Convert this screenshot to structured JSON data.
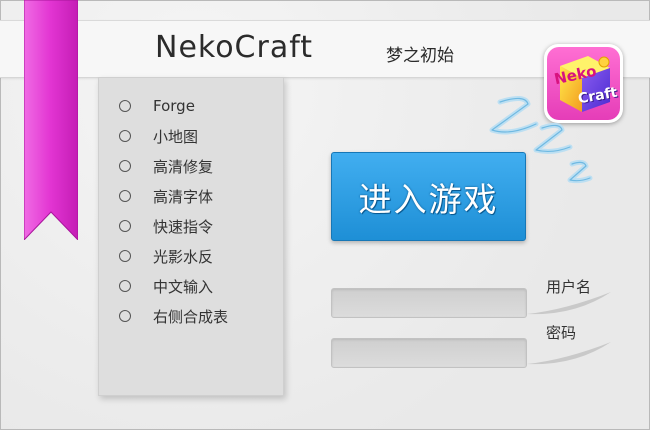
{
  "app": {
    "title": "NekoCraft",
    "subtitle": "梦之初始"
  },
  "logo": {
    "text_top": "Neko",
    "text_bottom": "Craft"
  },
  "options": [
    {
      "label": "Forge"
    },
    {
      "label": "小地图"
    },
    {
      "label": "高清修复"
    },
    {
      "label": "高清字体"
    },
    {
      "label": "快速指令"
    },
    {
      "label": "光影水反"
    },
    {
      "label": "中文输入"
    },
    {
      "label": "右侧合成表"
    }
  ],
  "play_button": {
    "label": "进入游戏"
  },
  "login": {
    "username_label": "用户名",
    "username_value": "",
    "password_label": "密码",
    "password_value": ""
  },
  "colors": {
    "ribbon": "#e63ad6",
    "play": "#2a9be3",
    "zzz": "#b8dff3"
  },
  "icons": {
    "ribbon": "bookmark-ribbon-icon",
    "sleep": "zzz-icon",
    "logo": "app-logo-icon"
  }
}
